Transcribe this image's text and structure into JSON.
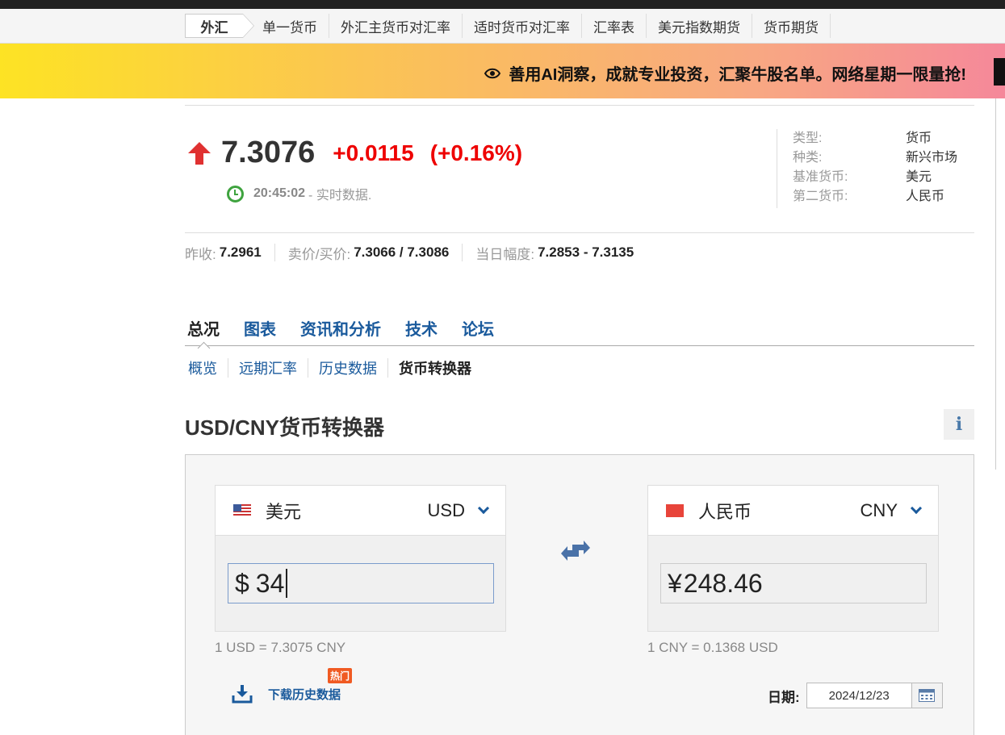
{
  "subnav": {
    "home": "外汇",
    "items": [
      "单一货币",
      "外汇主货币对汇率",
      "适时货币对汇率",
      "汇率表",
      "美元指数期货",
      "货币期货"
    ]
  },
  "banner": {
    "icon": "eye-icon",
    "text": "善用AI洞察，成就专业投资，汇聚牛股名单。网络星期一限量抢!"
  },
  "quote": {
    "price": "7.3076",
    "change": "+0.0115",
    "change_pct": "(+0.16%)",
    "direction": "up",
    "time": "20:45:02",
    "time_suffix": "- 实时数据."
  },
  "info": [
    {
      "k": "类型:",
      "v": "货币"
    },
    {
      "k": "种类:",
      "v": "新兴市场"
    },
    {
      "k": "基准货币:",
      "v": "美元"
    },
    {
      "k": "第二货币:",
      "v": "人民币"
    }
  ],
  "stats": [
    {
      "k": "昨收:",
      "v": "7.2961"
    },
    {
      "k": "卖价/买价:",
      "v": "7.3066 / 7.3086"
    },
    {
      "k": "当日幅度:",
      "v": "7.2853 - 7.3135"
    }
  ],
  "tabs": [
    "总况",
    "图表",
    "资讯和分析",
    "技术",
    "论坛"
  ],
  "subtabs": [
    "概览",
    "远期汇率",
    "历史数据",
    "货币转换器"
  ],
  "converter": {
    "title": "USD/CNY货币转换器",
    "info_icon": "i",
    "from": {
      "name": "美元",
      "code": "USD",
      "symbol": "$",
      "amount": "34",
      "rate_note": "1 USD = 7.3075 CNY"
    },
    "to": {
      "name": "人民币",
      "code": "CNY",
      "symbol": "¥",
      "amount": "248.46",
      "rate_note": "1 CNY = 0.1368 USD"
    },
    "download_label": "下载历史数据",
    "hot_badge": "热门",
    "date_label": "日期:",
    "date_value": "2024/12/23"
  },
  "colors": {
    "up": "#e00000",
    "link": "#1a5a9c",
    "clock": "#3fa33f"
  }
}
